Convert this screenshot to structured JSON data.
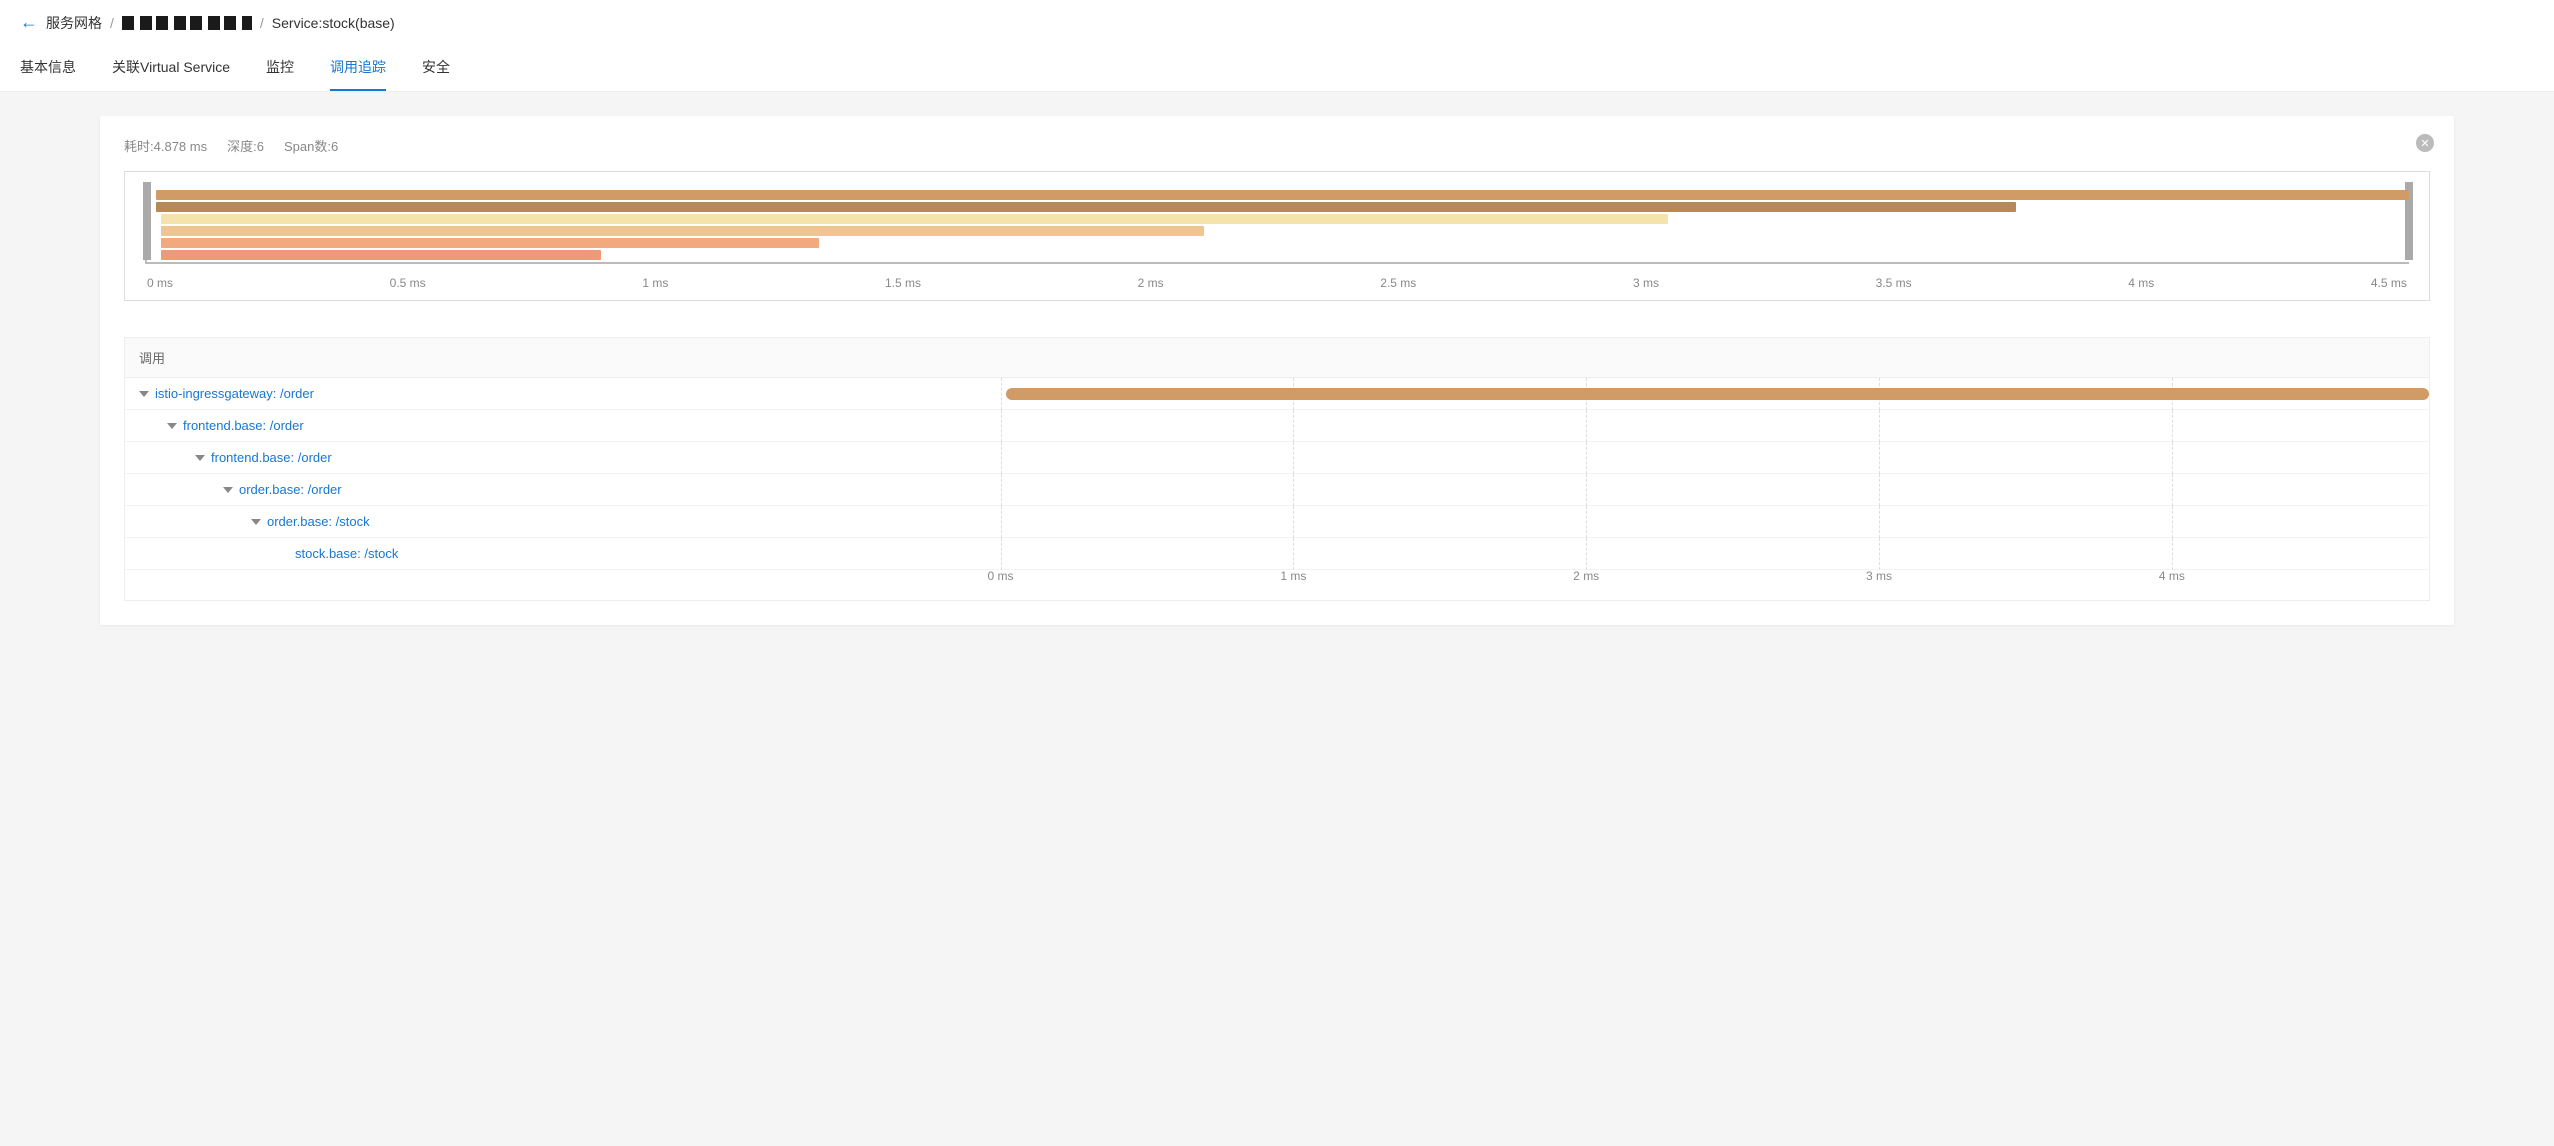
{
  "breadcrumb": {
    "root": "服务网格",
    "current": "Service:stock(base)"
  },
  "tabs": [
    "基本信息",
    "关联Virtual Service",
    "监控",
    "调用追踪",
    "安全"
  ],
  "active_tab": 3,
  "summary": {
    "duration_label": "耗时:",
    "duration_value": "4.878 ms",
    "depth_label": "深度:",
    "depth_value": "6",
    "spancount_label": "Span数:",
    "spancount_value": "6"
  },
  "chart_data": {
    "type": "bar",
    "title": "",
    "xlabel": "",
    "ylabel": "",
    "x_ticks": [
      "0 ms",
      "0.5 ms",
      "1 ms",
      "1.5 ms",
      "2 ms",
      "2.5 ms",
      "3 ms",
      "3.5 ms",
      "4 ms",
      "4.5 ms"
    ],
    "xlim": [
      0,
      4.878
    ],
    "spans": [
      {
        "name": "istio-ingressgateway: /order",
        "start": 0.02,
        "end": 4.878,
        "color": "#d19b65"
      },
      {
        "name": "frontend.base: /order",
        "start": 0.02,
        "end": 4.03,
        "color": "#b58a56"
      },
      {
        "name": "frontend.base: /order",
        "start": 0.03,
        "end": 3.28,
        "color": "#f5e3ad"
      },
      {
        "name": "order.base: /order",
        "start": 0.03,
        "end": 2.28,
        "color": "#f1c58e"
      },
      {
        "name": "order.base: /stock",
        "start": 0.03,
        "end": 1.45,
        "color": "#f2a97e"
      },
      {
        "name": "stock.base: /stock",
        "start": 0.03,
        "end": 0.98,
        "color": "#ee9a77"
      }
    ]
  },
  "call_section": {
    "header": "调用",
    "detail_ticks": [
      "0 ms",
      "1 ms",
      "2 ms",
      "3 ms",
      "4 ms"
    ],
    "rows": [
      {
        "indent": 0,
        "label": "istio-ingressgateway: /order",
        "has_children": true,
        "bar_start": 0.02,
        "bar_end": 4.878,
        "color": "#d19b65"
      },
      {
        "indent": 1,
        "label": "frontend.base: /order",
        "has_children": true
      },
      {
        "indent": 2,
        "label": "frontend.base: /order",
        "has_children": true
      },
      {
        "indent": 3,
        "label": "order.base: /order",
        "has_children": true
      },
      {
        "indent": 4,
        "label": "order.base: /stock",
        "has_children": true
      },
      {
        "indent": 5,
        "label": "stock.base: /stock",
        "has_children": false
      }
    ]
  }
}
